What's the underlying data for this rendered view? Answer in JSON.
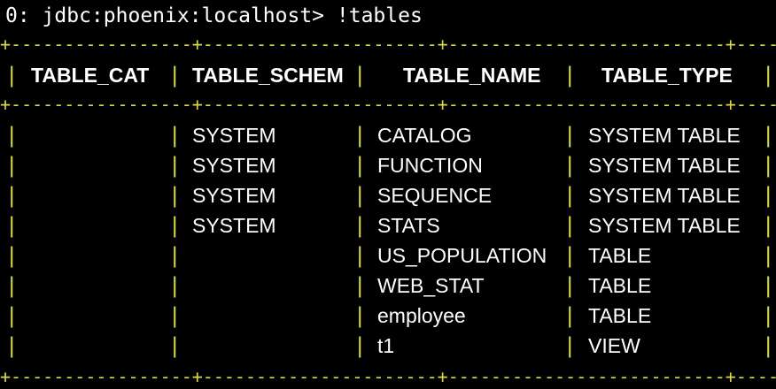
{
  "terminal": {
    "prompt": "0: jdbc:phoenix:localhost> !tables",
    "border_segments": [
      "+-----------------+",
      "----------------------+",
      "--------------------------+",
      "-----------------------+"
    ],
    "colors": {
      "background": "#000000",
      "text": "#ffffff",
      "border": "#d8d84a"
    }
  },
  "table": {
    "columns": [
      "TABLE_CAT",
      "TABLE_SCHEM",
      "TABLE_NAME",
      "TABLE_TYPE"
    ],
    "rows": [
      {
        "cat": "",
        "schem": "SYSTEM",
        "name": "CATALOG",
        "type": "SYSTEM TABLE"
      },
      {
        "cat": "",
        "schem": "SYSTEM",
        "name": "FUNCTION",
        "type": "SYSTEM TABLE"
      },
      {
        "cat": "",
        "schem": "SYSTEM",
        "name": "SEQUENCE",
        "type": "SYSTEM TABLE"
      },
      {
        "cat": "",
        "schem": "SYSTEM",
        "name": "STATS",
        "type": "SYSTEM TABLE"
      },
      {
        "cat": "",
        "schem": "",
        "name": "US_POPULATION",
        "type": "TABLE"
      },
      {
        "cat": "",
        "schem": "",
        "name": "WEB_STAT",
        "type": "TABLE"
      },
      {
        "cat": "",
        "schem": "",
        "name": "employee",
        "type": "TABLE"
      },
      {
        "cat": "",
        "schem": "",
        "name": "t1",
        "type": "VIEW"
      }
    ]
  }
}
